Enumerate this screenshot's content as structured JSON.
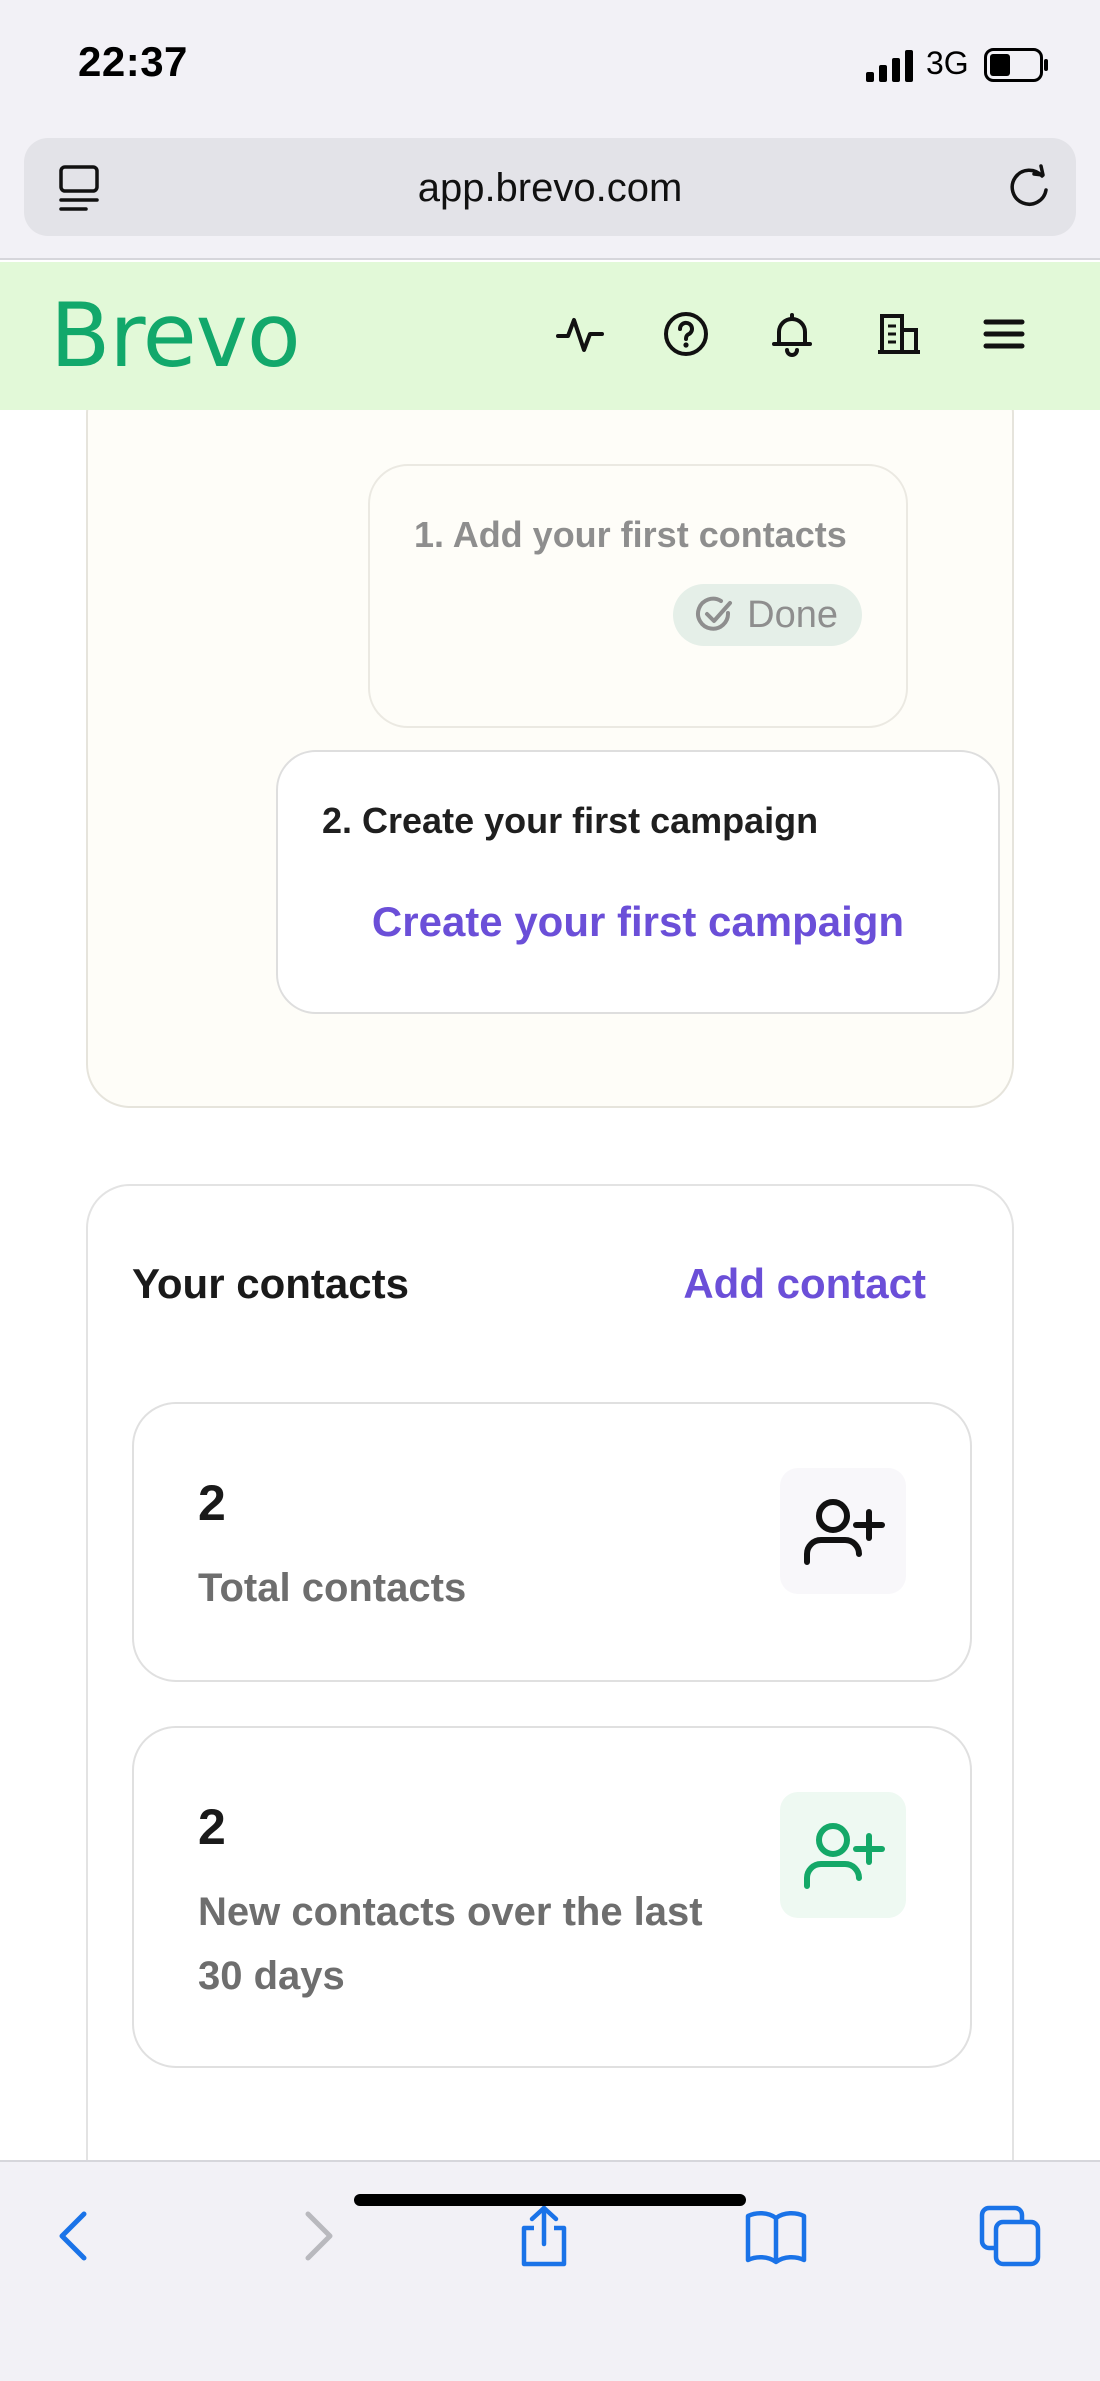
{
  "status_bar": {
    "time": "22:37",
    "network": "3G"
  },
  "browser": {
    "url": "app.brevo.com"
  },
  "app_header": {
    "logo": "Brevo",
    "icons": [
      "activity-icon",
      "help-icon",
      "bell-icon",
      "building-icon",
      "menu-icon"
    ]
  },
  "onboarding": {
    "step1": {
      "title": "1. Add your first contacts",
      "status": "Done"
    },
    "step2": {
      "title": "2. Create your first campaign",
      "link": "Create your first campaign"
    }
  },
  "contacts": {
    "title": "Your contacts",
    "add_link": "Add contact",
    "stats": [
      {
        "value": "2",
        "label": "Total contacts",
        "icon": "add-user-icon"
      },
      {
        "value": "2",
        "label": "New contacts over the last 30 days",
        "icon": "add-user-icon"
      }
    ]
  },
  "toolbar": {
    "icons": [
      "back-icon",
      "forward-icon",
      "share-icon",
      "bookmarks-icon",
      "tabs-icon"
    ]
  },
  "colors": {
    "brand_green": "#12a86b",
    "accent_purple": "#6b4fd8",
    "header_bg": "#e2f9d8"
  }
}
